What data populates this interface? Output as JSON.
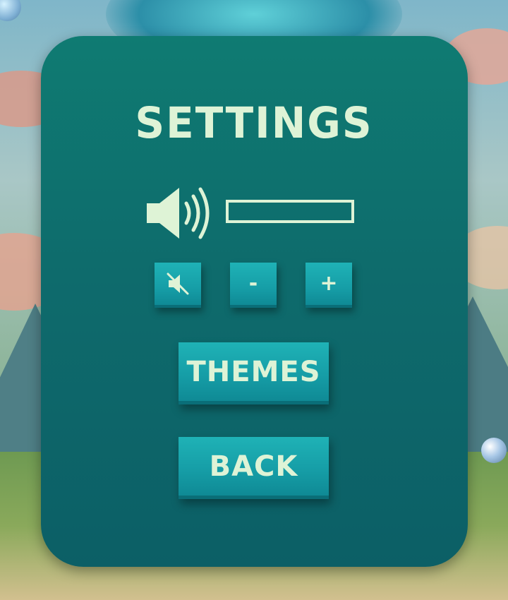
{
  "screen": {
    "title": "SETTINGS"
  },
  "volume": {
    "icon": "speaker-icon",
    "level": 0.0,
    "mute_icon": "speaker-muted-icon",
    "minus_label": "-",
    "plus_label": "+"
  },
  "menu": {
    "themes_label": "THEMES",
    "back_label": "BACK"
  },
  "colors": {
    "panel": "#0e6b6c",
    "button": "#169ea7",
    "text": "#def3d6"
  }
}
